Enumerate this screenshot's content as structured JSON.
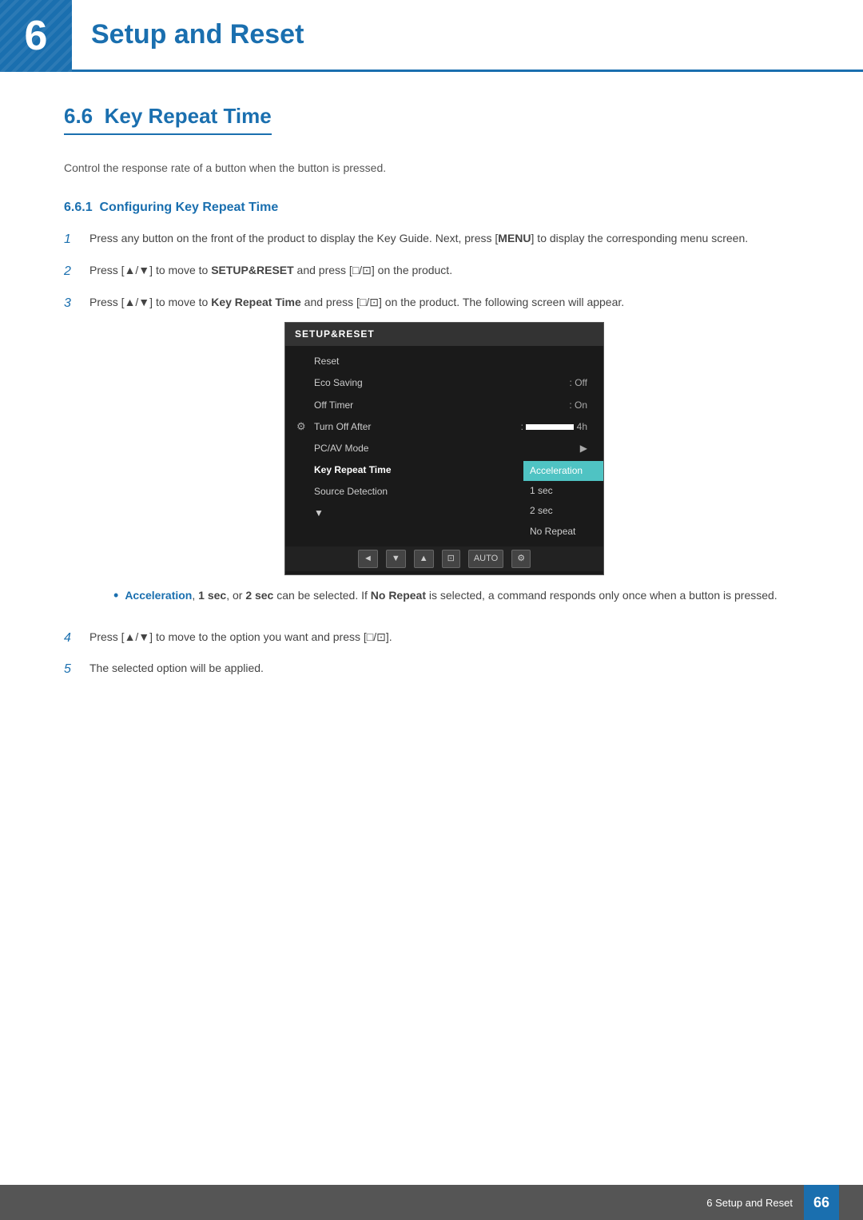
{
  "chapter": {
    "number": "6",
    "title": "Setup and Reset"
  },
  "section": {
    "number": "6.6",
    "title": "Key Repeat Time",
    "description": "Control the response rate of a button when the button is pressed."
  },
  "subsection": {
    "number": "6.6.1",
    "title": "Configuring Key Repeat Time"
  },
  "steps": [
    {
      "num": "1",
      "text": "Press any button on the front of the product to display the Key Guide. Next, press [MENU] to display the corresponding menu screen."
    },
    {
      "num": "2",
      "text": "Press [▲/▼] to move to SETUP&RESET and press [□/⊡] on the product."
    },
    {
      "num": "3",
      "text": "Press [▲/▼] to move to Key Repeat Time and press [□/⊡] on the product. The following screen will appear."
    },
    {
      "num": "4",
      "text": "Press [▲/▼] to move to the option you want and press [□/⊡]."
    },
    {
      "num": "5",
      "text": "The selected option will be applied."
    }
  ],
  "menu": {
    "title": "SETUP&RESET",
    "items": [
      {
        "label": "Reset",
        "value": "",
        "hasGear": false
      },
      {
        "label": "Eco Saving",
        "value": "Off",
        "hasGear": false
      },
      {
        "label": "Off Timer",
        "value": "On",
        "hasGear": false
      },
      {
        "label": "Turn Off After",
        "value": "bar",
        "suffix": "4h",
        "hasGear": true
      },
      {
        "label": "PC/AV Mode",
        "value": "arrow",
        "hasGear": false
      },
      {
        "label": "Key Repeat Time",
        "value": "submenu",
        "hasGear": false,
        "highlighted": true
      },
      {
        "label": "Source Detection",
        "value": "",
        "hasGear": false
      }
    ],
    "submenu_options": [
      "Acceleration",
      "1 sec",
      "2 sec",
      "No Repeat"
    ],
    "submenu_selected": "Acceleration",
    "bottom_buttons": [
      "◄",
      "▼",
      "▲",
      "⊡",
      "AUTO",
      "⚙"
    ]
  },
  "bullet": {
    "text_before": "Acceleration, 1 sec, or 2 sec can be selected. If No Repeat is selected, a command responds only once when a button is pressed.",
    "bold_items": [
      "Acceleration",
      "1 sec",
      "2 sec",
      "No Repeat"
    ]
  },
  "footer": {
    "text": "6 Setup and Reset",
    "page": "66"
  }
}
